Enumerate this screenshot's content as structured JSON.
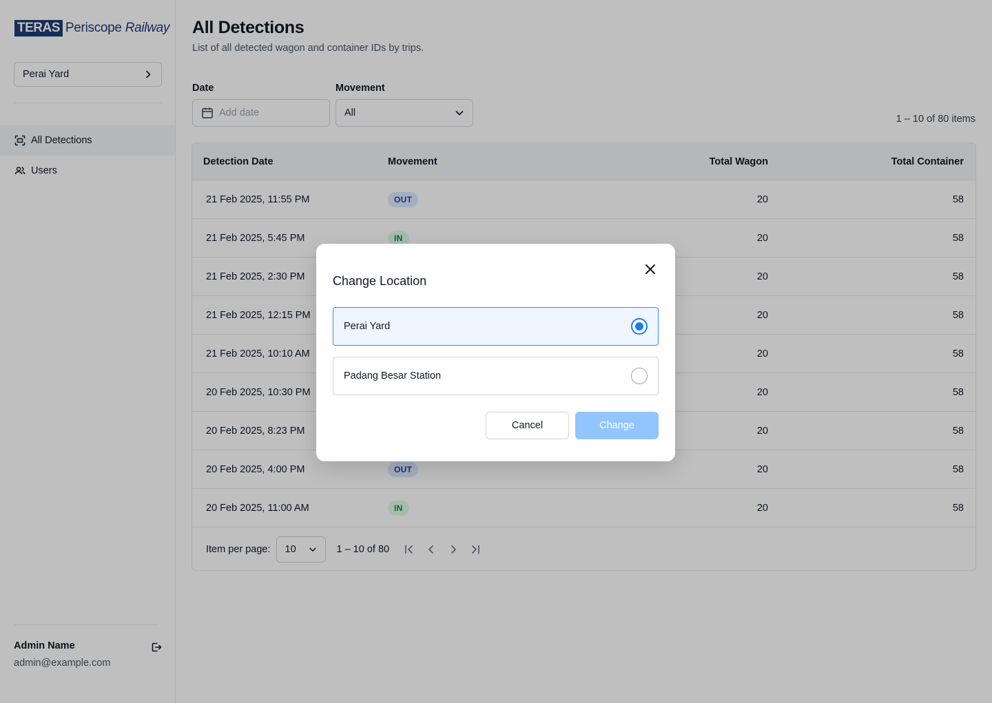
{
  "brand": {
    "mark": "TERAS",
    "name": "Periscope",
    "name_italic": "Railway"
  },
  "sidebar": {
    "location": "Perai Yard",
    "nav": [
      {
        "label": "All Detections",
        "icon": "scan-icon",
        "active": true
      },
      {
        "label": "Users",
        "icon": "users-icon",
        "active": false
      }
    ],
    "user": {
      "name": "Admin Name",
      "email": "admin@example.com"
    }
  },
  "page": {
    "title": "All Detections",
    "subtitle": "List of all detected wagon and container IDs by trips."
  },
  "filters": {
    "date_label": "Date",
    "date_placeholder": "Add date",
    "movement_label": "Movement",
    "movement_value": "All"
  },
  "count_summary": "1 –  10 of 80 items",
  "table": {
    "columns": [
      "Detection Date",
      "Movement",
      "Total Wagon",
      "Total Container"
    ],
    "rows": [
      {
        "date": "21 Feb 2025, 11:55 PM",
        "movement": "OUT",
        "wagon": "20",
        "container": "58"
      },
      {
        "date": "21 Feb 2025, 5:45 PM",
        "movement": "IN",
        "wagon": "20",
        "container": "58"
      },
      {
        "date": "21 Feb 2025, 2:30 PM",
        "movement": "",
        "wagon": "20",
        "container": "58"
      },
      {
        "date": "21 Feb 2025, 12:15 PM",
        "movement": "",
        "wagon": "20",
        "container": "58"
      },
      {
        "date": "21 Feb 2025, 10:10 AM",
        "movement": "",
        "wagon": "20",
        "container": "58"
      },
      {
        "date": "20 Feb 2025, 10:30 PM",
        "movement": "",
        "wagon": "20",
        "container": "58"
      },
      {
        "date": "20 Feb 2025, 8:23 PM",
        "movement": "",
        "wagon": "20",
        "container": "58"
      },
      {
        "date": "20 Feb 2025, 4:00 PM",
        "movement": "OUT",
        "wagon": "20",
        "container": "58"
      },
      {
        "date": "20 Feb 2025, 11:00 AM",
        "movement": "IN",
        "wagon": "20",
        "container": "58"
      }
    ]
  },
  "pager": {
    "label": "Item per page:",
    "per_page": "10",
    "range": "1 –  10 of 80"
  },
  "modal": {
    "title": "Change Location",
    "options": [
      {
        "label": "Perai Yard",
        "selected": true
      },
      {
        "label": "Padang Besar Station",
        "selected": false
      }
    ],
    "cancel": "Cancel",
    "confirm": "Change"
  },
  "colors": {
    "brand": "#1f3b73",
    "accent": "#1d7bf0",
    "out_badge": "#dbeafe",
    "in_badge": "#dcfce7",
    "change_disabled": "#93c5fd"
  }
}
